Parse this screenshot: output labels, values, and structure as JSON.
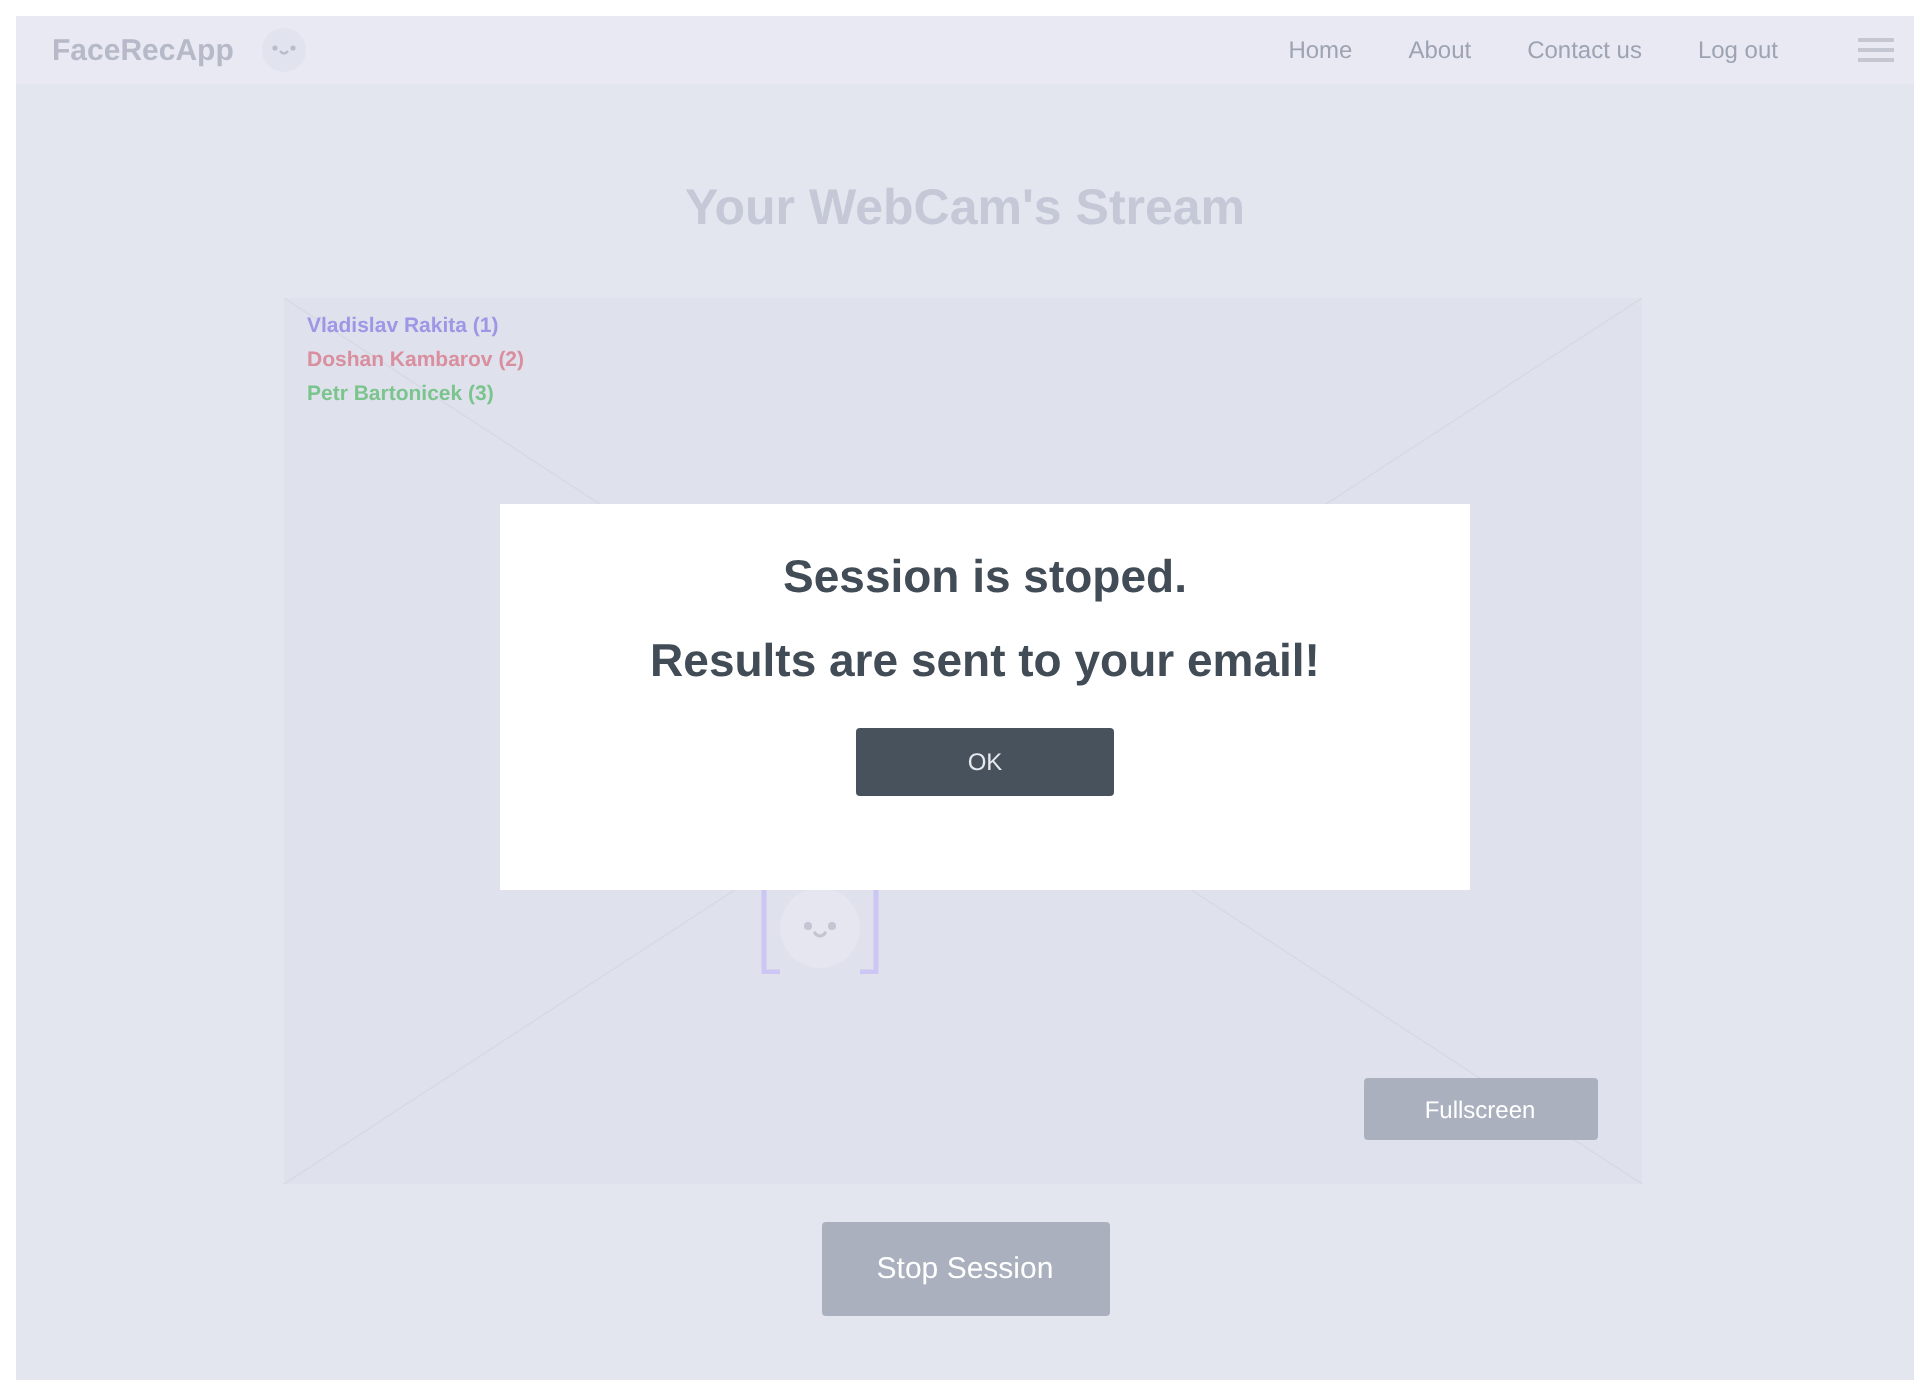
{
  "navbar": {
    "brand": "FaceRecApp",
    "links": [
      "Home",
      "About",
      "Contact us",
      "Log out"
    ]
  },
  "title": "Your WebCam's Stream",
  "stream": {
    "people": [
      {
        "label": "Vladislav Rakita (1)",
        "color": "#9d97e6"
      },
      {
        "label": "Doshan Kambarov (2)",
        "color": "#d98f9f"
      },
      {
        "label": "Petr Bartonicek (3)",
        "color": "#7cc48d"
      }
    ],
    "fullscreen_button": "Fullscreen"
  },
  "stop_button": "Stop Session",
  "dialog": {
    "lines": [
      "Session is stoped.",
      "Results are sent to your email!"
    ],
    "button": "OK"
  }
}
